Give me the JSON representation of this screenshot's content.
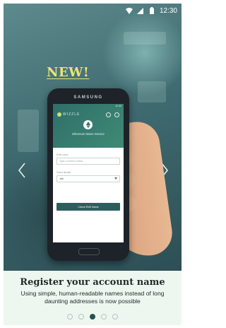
{
  "status_bar": {
    "time": "12:30",
    "icons": [
      "wifi-icon",
      "signal-icon",
      "battery-icon"
    ]
  },
  "hero": {
    "new_label": "NEW!",
    "phone": {
      "brand": "SAMSUNG",
      "app_name": "WIZZLE",
      "service_title": "Ethereum Name Service",
      "fields": [
        {
          "label": "Enter name",
          "placeholder": "Type a name to check"
        },
        {
          "label": "Select domain",
          "value": ".eth"
        }
      ],
      "button_label": "Check ENS Name"
    }
  },
  "slide": {
    "title": "Register your account name",
    "subtitle": "Using simple, human-readable names instead of long daunting addresses is now possible"
  },
  "pagination": {
    "total": 5,
    "active_index": 2
  },
  "colors": {
    "accent": "#24534f",
    "new_label": "#f0e27a",
    "background": "#eef7ef"
  }
}
